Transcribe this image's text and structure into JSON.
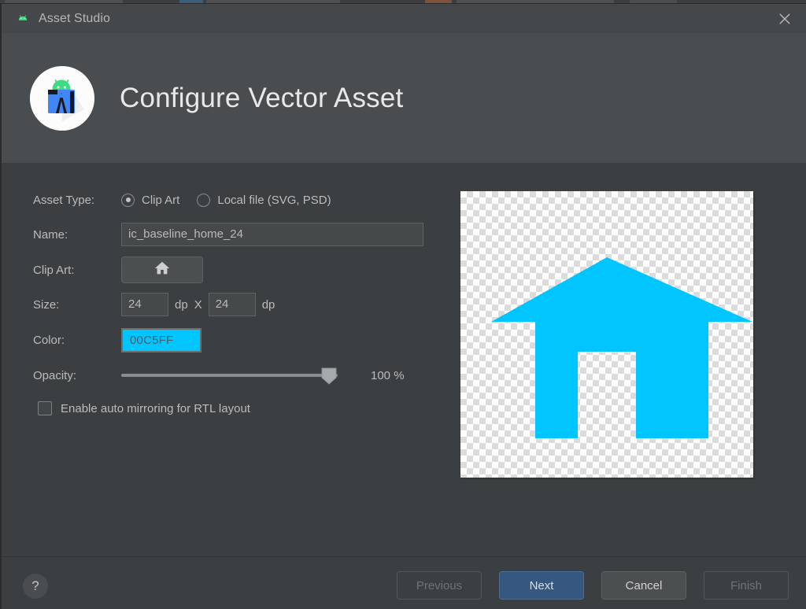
{
  "window": {
    "title": "Asset Studio",
    "app_icon": "android-robot-icon",
    "close_icon": "close-icon"
  },
  "header": {
    "title": "Configure Vector Asset",
    "logo_icon": "android-studio-logo-icon"
  },
  "form": {
    "asset_type": {
      "label": "Asset Type:",
      "options": [
        {
          "label": "Clip Art",
          "selected": true
        },
        {
          "label": "Local file (SVG, PSD)",
          "selected": false
        }
      ]
    },
    "name": {
      "label": "Name:",
      "value": "ic_baseline_home_24",
      "placeholder": "ic_baseline_home_24"
    },
    "clip_art": {
      "label": "Clip Art:",
      "button_icon": "home-icon"
    },
    "size": {
      "label": "Size:",
      "width_value": "24",
      "height_value": "24",
      "unit": "dp",
      "separator": "X"
    },
    "color": {
      "label": "Color:",
      "hex_text": "00C5FF",
      "swatch_color": "#00C5FF"
    },
    "opacity": {
      "label": "Opacity:",
      "value": 100,
      "value_text": "100 %",
      "min": 0,
      "max": 100
    },
    "rtl_mirroring": {
      "label": "Enable auto mirroring for RTL layout",
      "checked": false
    }
  },
  "preview": {
    "icon": "home-icon",
    "icon_color": "#00C5FF",
    "background": "transparent-checkerboard"
  },
  "footer": {
    "help_label": "?",
    "buttons": [
      {
        "label": "Previous",
        "state": "disabled"
      },
      {
        "label": "Next",
        "state": "primary"
      },
      {
        "label": "Cancel",
        "state": "normal"
      },
      {
        "label": "Finish",
        "state": "disabled"
      }
    ]
  },
  "colors": {
    "accent": "#00C5FF",
    "primary_button": "#365880",
    "dialog_bg": "#3c3f41",
    "header_bg": "#4a4d4f"
  }
}
